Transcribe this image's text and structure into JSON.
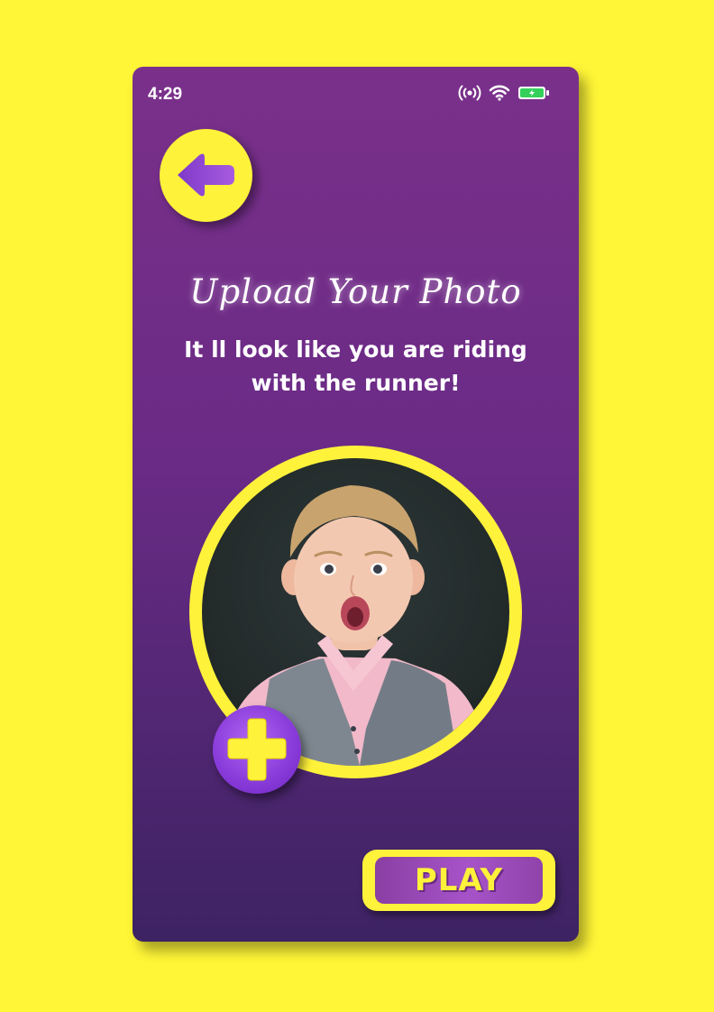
{
  "status_bar": {
    "time": "4:29",
    "icons": [
      "hotspot-icon",
      "wifi-icon",
      "battery-charging-icon"
    ]
  },
  "header": {
    "back_icon": "arrow-left-icon"
  },
  "content": {
    "title": "Upload Your Photo",
    "subtitle_line1": "It ll look like you are riding",
    "subtitle_line2": "with the runner!"
  },
  "photo": {
    "description_icon": "child-portrait"
  },
  "add_photo": {
    "icon": "plus-icon"
  },
  "play_button": {
    "label": "PLAY"
  },
  "colors": {
    "background": "#FFF637",
    "phone_top": "#7A308A",
    "phone_bottom": "#3D2363",
    "accent_yellow": "#FFF23A",
    "accent_purple": "#8B3DDB",
    "battery_green": "#35D05A"
  }
}
